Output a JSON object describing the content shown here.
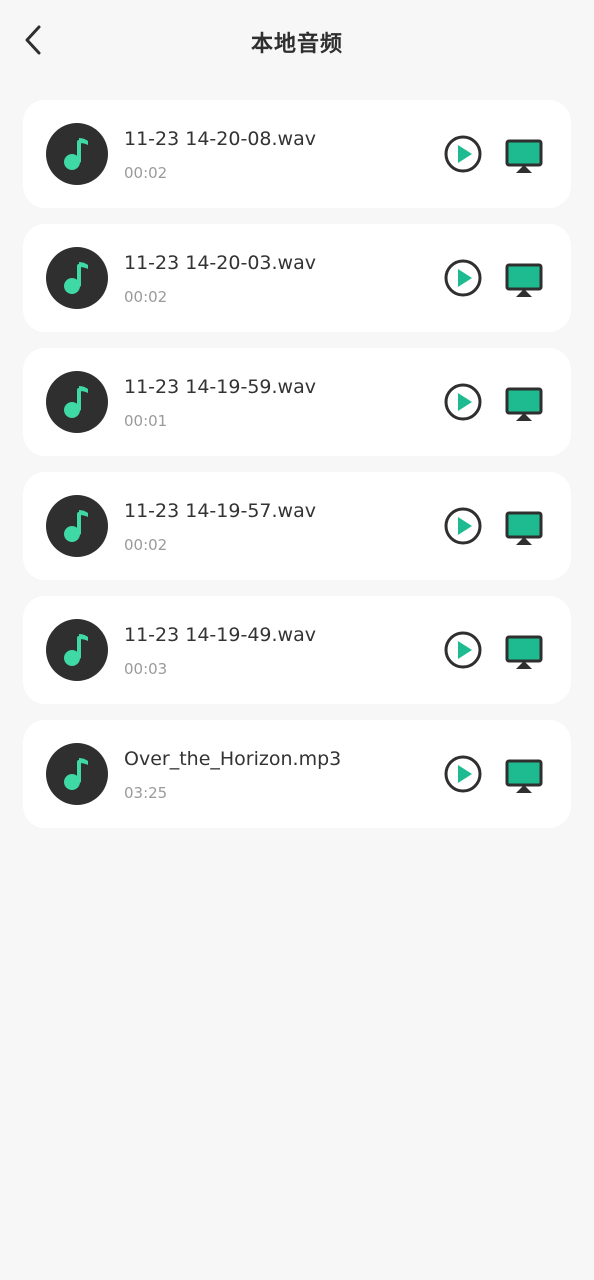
{
  "header": {
    "title": "本地音频"
  },
  "colors": {
    "accent": "#1dbb8f",
    "disc": "#2f2f2f",
    "background": "#f7f7f7",
    "card": "#ffffff"
  },
  "icons": {
    "back": "chevron-left-icon",
    "note": "music-note-icon",
    "play": "play-circle-icon",
    "cast": "screen-cast-icon"
  },
  "items": [
    {
      "name": "11-23 14-20-08.wav",
      "duration": "00:02"
    },
    {
      "name": "11-23 14-20-03.wav",
      "duration": "00:02"
    },
    {
      "name": "11-23 14-19-59.wav",
      "duration": "00:01"
    },
    {
      "name": "11-23 14-19-57.wav",
      "duration": "00:02"
    },
    {
      "name": "11-23 14-19-49.wav",
      "duration": "00:03"
    },
    {
      "name": "Over_the_Horizon.mp3",
      "duration": "03:25"
    }
  ]
}
